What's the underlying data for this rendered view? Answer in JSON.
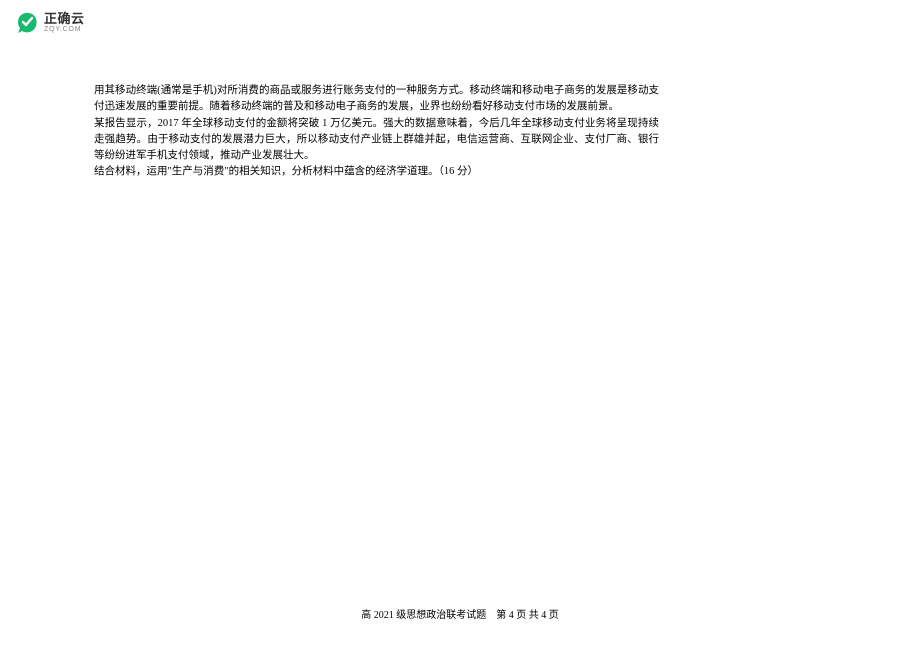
{
  "logo": {
    "cn": "正确云",
    "en": "ZQY.COM"
  },
  "body": {
    "p1": "用其移动终端(通常是手机)对所消费的商品或服务进行账务支付的一种服务方式。移动终端和移动电子商务的发展是移动支付迅速发展的重要前提。随着移动终端的普及和移动电子商务的发展，业界也纷纷看好移动支付市场的发展前景。",
    "p2": "某报告显示，2017 年全球移动支付的金额将突破 1 万亿美元。强大的数据意味着，今后几年全球移动支付业务将呈现持续走强趋势。由于移动支付的发展潜力巨大，所以移动支付产业链上群雄并起，电信运营商、互联网企业、支付厂商、银行等纷纷进军手机支付领域，推动产业发展壮大。",
    "p3": "结合材料，运用\"生产与消费\"的相关知识，分析材料中蕴含的经济学道理。（16 分）"
  },
  "footer": {
    "left": "高 2021 级思想政治联考试题",
    "right": "第 4 页 共 4 页"
  }
}
